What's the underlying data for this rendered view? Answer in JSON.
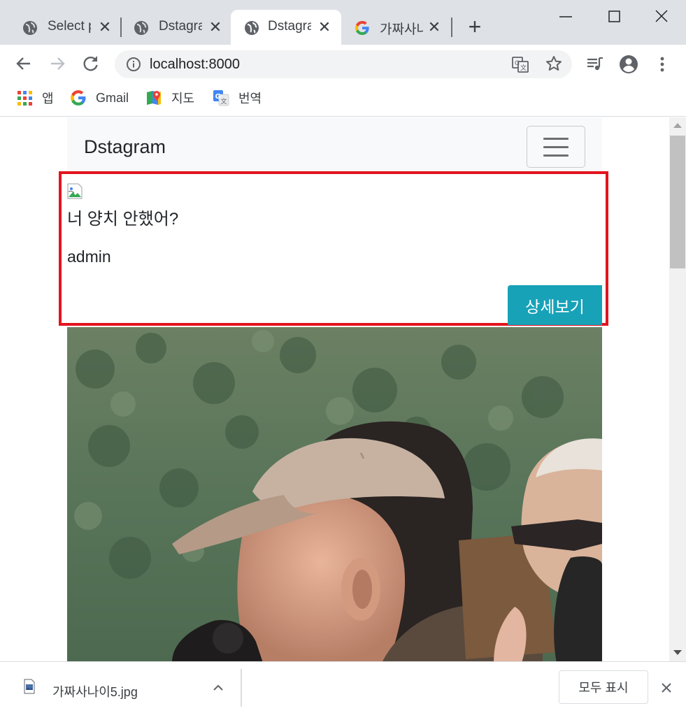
{
  "browser": {
    "tabs": [
      {
        "title": "Select p",
        "icon": "globe-icon",
        "active": false
      },
      {
        "title": "Dstagra",
        "icon": "globe-icon",
        "active": false
      },
      {
        "title": "Dstagra",
        "icon": "globe-icon",
        "active": true
      },
      {
        "title": "가짜사나",
        "icon": "google-g-icon",
        "active": false
      }
    ],
    "new_tab_label": "+",
    "address": "localhost:8000",
    "bookmarks": [
      {
        "label": "앱",
        "icon": "apps-grid-icon"
      },
      {
        "label": "Gmail",
        "icon": "google-g-icon"
      },
      {
        "label": "지도",
        "icon": "maps-pin-icon"
      },
      {
        "label": "번역",
        "icon": "translate-icon"
      }
    ]
  },
  "page": {
    "brand": "Dstagram",
    "post": {
      "caption": "너 양치 안했어?",
      "author": "admin",
      "detail_button": "상세보기"
    },
    "highlight_color": "#e3141e",
    "button_color": "#17a2b8"
  },
  "downloads": {
    "file_name": "가짜사나이5.jpg",
    "show_all_label": "모두 표시"
  }
}
